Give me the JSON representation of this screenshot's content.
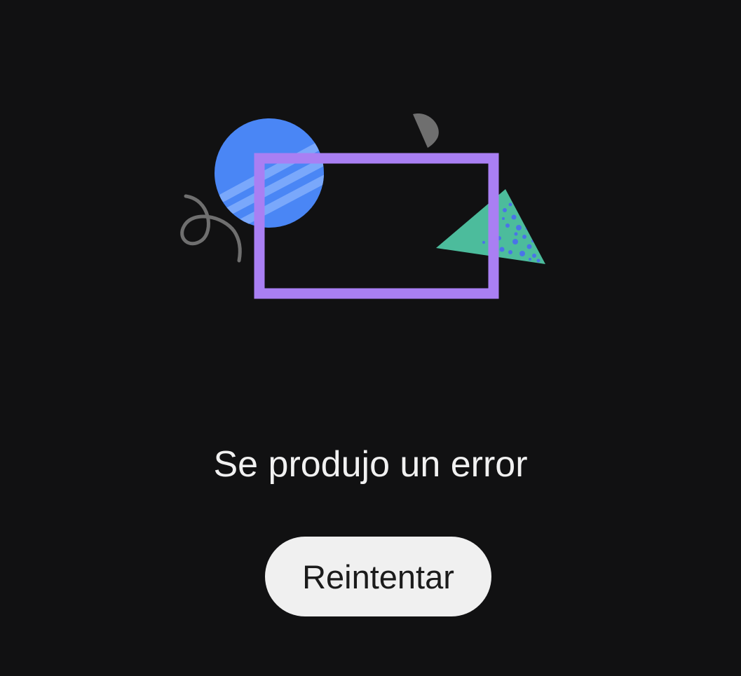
{
  "error": {
    "title": "Se produjo un error",
    "illustration_icon": "broken-frame-shapes-illustration"
  },
  "actions": {
    "retry_label": "Reintentar"
  },
  "colors": {
    "background": "#111112",
    "frame": "#a97ff3",
    "circle": "#4a86f5",
    "triangle": "#4cbc9c",
    "scribble": "#6f6f6f",
    "button_bg": "#f0f0f0",
    "button_text": "#1b1b1b",
    "title_text": "#f1f1f1"
  }
}
